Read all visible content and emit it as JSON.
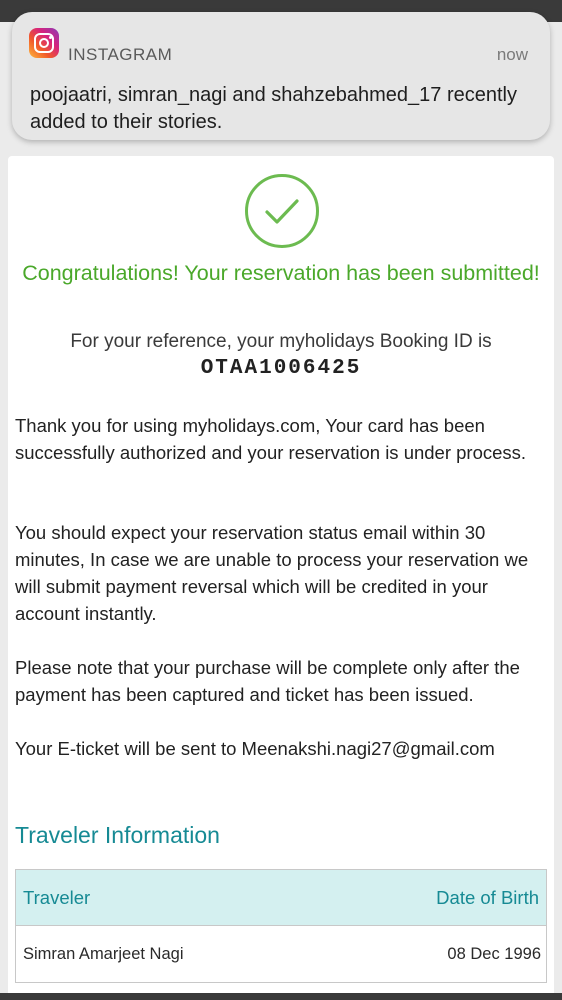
{
  "notification": {
    "app": "INSTAGRAM",
    "time": "now",
    "message": "poojaatri, simran_nagi and shahzebahmed_17 recently added to their stories.",
    "icon": "instagram-icon"
  },
  "confirmation": {
    "icon": "check-circle-icon",
    "accent_color": "#4aa82a",
    "title": "Congratulations! Your reservation has been submitted!",
    "reference_text": "For your reference, your myholidays Booking ID is",
    "booking_id": "OTAA1006425",
    "paragraphs": [
      "Thank you for using myholidays.com, Your card has been successfully authorized and your reservation is under process.",
      "You should expect your reservation status email within 30 minutes, In case we are unable to process your reservation we will submit payment reversal which will be credited in your account instantly.",
      "Please note that your purchase will be complete only after the payment has been captured and ticket has been issued.",
      "Your E-ticket will be sent to Meenakshi.nagi27@gmail.com"
    ]
  },
  "traveler_info": {
    "title": "Traveler Information",
    "title_color": "#168a94",
    "header_bg": "#d4f0f0",
    "columns": [
      "Traveler",
      "Date of Birth"
    ],
    "rows": [
      [
        "Simran Amarjeet Nagi",
        "08 Dec 1996"
      ]
    ]
  }
}
